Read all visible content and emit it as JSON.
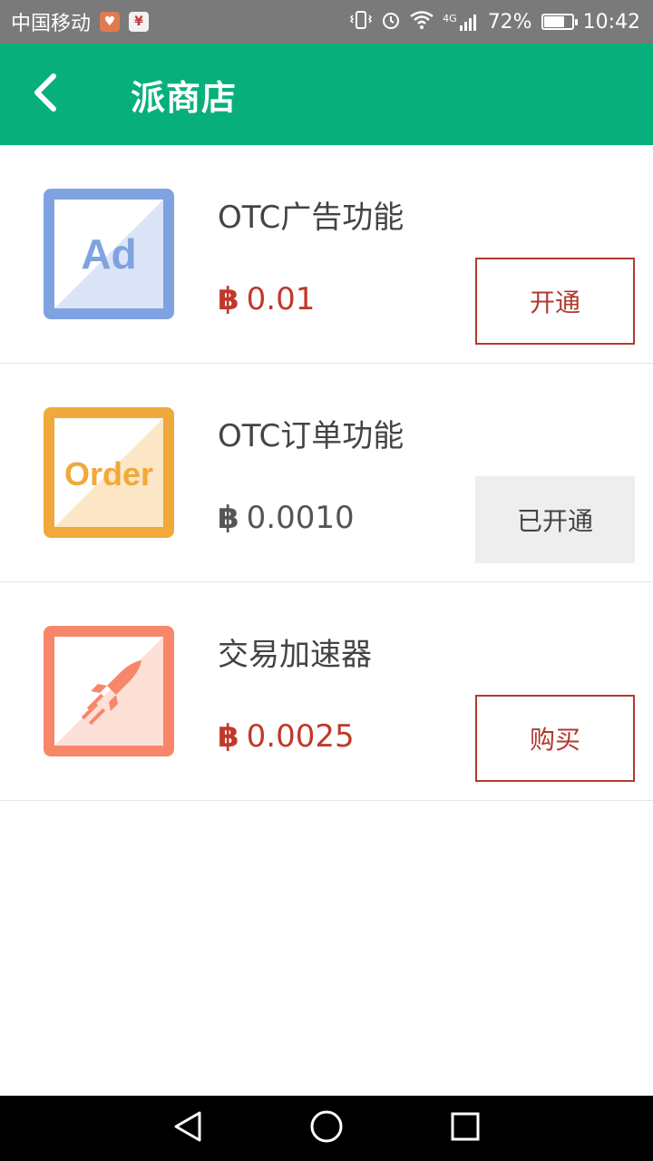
{
  "status_bar": {
    "carrier": "中国移动",
    "app_icon_1": "heart-app-icon",
    "app_icon_2_text": "¥",
    "signal_type": "4G",
    "battery_percent": "72%",
    "battery_level": 0.72,
    "time": "10:42"
  },
  "app_bar": {
    "title": "派商店",
    "back_icon": "chevron-left-icon"
  },
  "items": [
    {
      "name": "OTC广告功能",
      "icon_label": "Ad",
      "icon_color": "#7fa3e0",
      "btc_symbol": "฿",
      "price": "0.01",
      "price_color": "#c0392b",
      "action_label": "开通",
      "action_state": "enabled"
    },
    {
      "name": "OTC订单功能",
      "icon_label": "Order",
      "icon_color": "#f0a93a",
      "btc_symbol": "฿",
      "price": "0.0010",
      "price_color": "#555555",
      "action_label": "已开通",
      "action_state": "disabled"
    },
    {
      "name": "交易加速器",
      "icon_label": "rocket-icon",
      "icon_color": "#f8876a",
      "btc_symbol": "฿",
      "price": "0.0025",
      "price_color": "#c0392b",
      "action_label": "购买",
      "action_state": "enabled"
    }
  ],
  "nav_bar": {
    "back": "triangle-back-icon",
    "home": "circle-home-icon",
    "recents": "square-recents-icon"
  }
}
